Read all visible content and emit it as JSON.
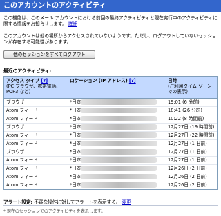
{
  "title": "このアカウントのアクティビティ",
  "intro": {
    "text": "この機能は、このメール アカウントにおける前回の最終アクティビティと現在実行中のアクティビティに関する情報をお知らせします。",
    "link": "詳細"
  },
  "note": "このアカウントは他の場所からアクセスされていないようです。ただし、ログアウトしていないセッションが存在する可能性があります。",
  "logout_button": "他のセッションをすべてログアウト",
  "recent_title": "最近のアクティビティ:",
  "table": {
    "headers": {
      "access_type": "アクセス タイプ",
      "access_type_link": "[?]",
      "access_type_sub": "(PC ブラウザ、携帯電話、POP3 など)",
      "location": "ロケーション (IP アドレス)",
      "location_link": "[?]",
      "date": "日時",
      "date_sub": "(ご利用タイム ゾーンでの表示)"
    },
    "rows": [
      {
        "type": "ブラウザ",
        "location": "*日本",
        "date": "19:01 (6 分前)"
      },
      {
        "type": "Atom フィード",
        "location": "*日本",
        "date": "18:41 (26 分前)"
      },
      {
        "type": "Atom フィード",
        "location": "*日本",
        "date": "10:22 (8 時間前)"
      },
      {
        "type": "ブラウザ",
        "location": "*日本",
        "date": "12月27日 (19 時間前)"
      },
      {
        "type": "Atom フィード",
        "location": "*日本",
        "date": "12月27日 (22 時間前)"
      },
      {
        "type": "Atom フィード",
        "location": "*日本",
        "date": "12月27日 (1 日前)"
      },
      {
        "type": "ブラウザ",
        "location": "*日本",
        "date": "12月27日 (1 日前)"
      },
      {
        "type": "Atom フィード",
        "location": "*日本",
        "date": "12月27日 (1 日前)"
      },
      {
        "type": "Atom フィード",
        "location": "*日本",
        "date": "12月26日 (2 日前)"
      },
      {
        "type": "Atom フィード",
        "location": "*日本",
        "date": "12月26日 (2 日前)"
      },
      {
        "type": "Atom フィード",
        "location": "*日本",
        "date": "12月26日 (2 日前)"
      }
    ]
  },
  "alert": {
    "label": "アラート設定:",
    "text": "不審な操作に対してアラートを表示する。",
    "link": "変更"
  },
  "footnote": "* 現在のセッションでのアクティビティを表示します。",
  "colors": {
    "title_bg": "#3366cc",
    "header_bg": "#c3d9ff",
    "link": "#0000cc"
  }
}
